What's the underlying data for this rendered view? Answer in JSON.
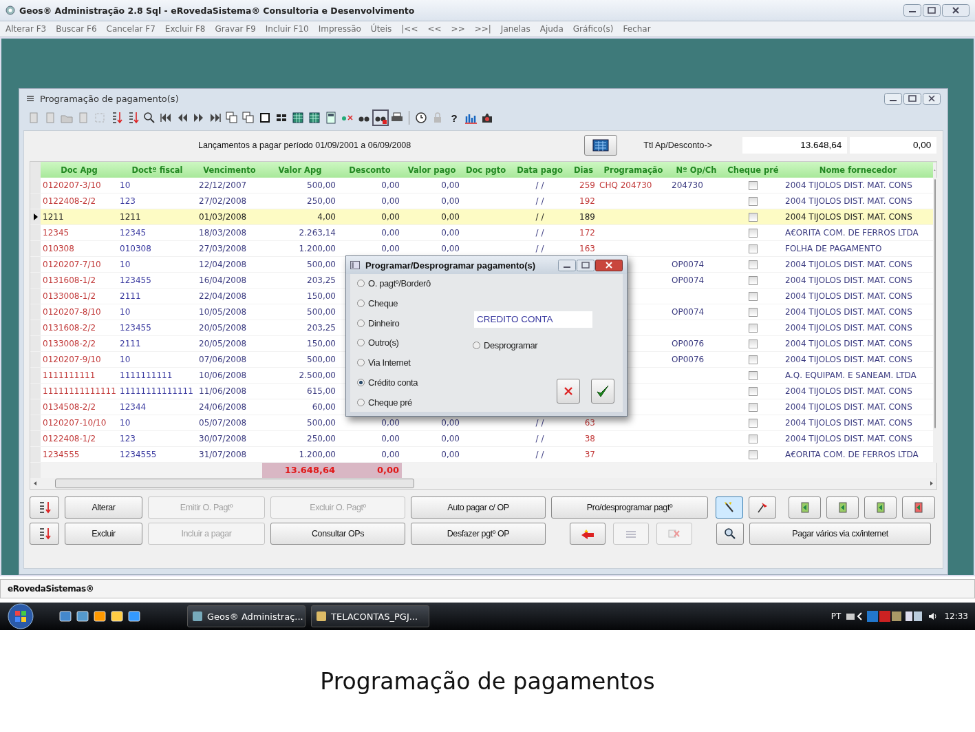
{
  "window": {
    "title": "Geos® Administração 2.8 Sql - eRovedaSistema® Consultoria e Desenvolvimento"
  },
  "menu": [
    "Alterar F3",
    "Buscar F6",
    "Cancelar F7",
    "Excluir F8",
    "Gravar F9",
    "Incluir F10",
    "Impressão",
    "Úteis",
    "|<<",
    "<<",
    ">>",
    ">>|",
    "Janelas",
    "Ajuda",
    "Gráfico(s)",
    "Fechar"
  ],
  "child_window": {
    "title": "Programação de pagamento(s)"
  },
  "toolbar": [
    {
      "kind": "icon",
      "pressed": false
    },
    {
      "kind": "icon",
      "pressed": false
    },
    {
      "kind": "icon",
      "pressed": false
    },
    {
      "kind": "icon",
      "pressed": false
    },
    {
      "kind": "icon",
      "pressed": false
    },
    {
      "kind": "icon",
      "pressed": false
    },
    {
      "kind": "icon",
      "pressed": false
    },
    {
      "kind": "icon",
      "pressed": false
    },
    {
      "kind": "icon",
      "pressed": false
    },
    {
      "kind": "icon",
      "pressed": false
    },
    {
      "kind": "icon",
      "pressed": false
    },
    {
      "kind": "icon",
      "pressed": false
    },
    {
      "kind": "icon",
      "pressed": false
    },
    {
      "kind": "icon",
      "pressed": false
    },
    {
      "kind": "icon",
      "pressed": false
    },
    {
      "kind": "icon",
      "pressed": false
    },
    {
      "kind": "icon",
      "pressed": false
    },
    {
      "kind": "icon",
      "pressed": false
    },
    {
      "kind": "icon",
      "pressed": false
    },
    {
      "kind": "icon",
      "pressed": false
    },
    {
      "kind": "icon",
      "pressed": false
    },
    {
      "kind": "icon",
      "pressed": true
    },
    {
      "kind": "icon",
      "pressed": false
    },
    {
      "kind": "separator"
    },
    {
      "kind": "icon",
      "pressed": false
    },
    {
      "kind": "icon",
      "pressed": false
    },
    {
      "kind": "text",
      "label": "?",
      "pressed": false
    },
    {
      "kind": "icon",
      "pressed": false
    },
    {
      "kind": "icon",
      "pressed": false
    }
  ],
  "period_label": "Lançamentos a pagar período 01/09/2001 a 06/09/2008",
  "totals_label": "Ttl Ap/Desconto->",
  "total_fields": [
    "13.648,64",
    "0,00"
  ],
  "table": {
    "columns": [
      "Doc Apg",
      "Doctº fiscal",
      "Vencimento",
      "Valor Apg",
      "Desconto",
      "Valor pago",
      "Doc pgto",
      "Data pago",
      "Dias",
      "Programação",
      "Nº Op/Ch",
      "Cheque pré",
      "Nome fornecedor"
    ],
    "rows": [
      {
        "doc": "0120207-3/10",
        "fiscal": "10",
        "venc": "22/12/2007",
        "valor": "500,00",
        "desc": "0,00",
        "pago": "0,00",
        "data": "/ /",
        "dias": "259",
        "prog": "CHQ 204730",
        "op": "204730",
        "cheque_pre": false,
        "forn": "2004 TIJOLOS DIST. MAT. CONS",
        "selected": false
      },
      {
        "doc": "0122408-2/2",
        "fiscal": "123",
        "venc": "27/02/2008",
        "valor": "250,00",
        "desc": "0,00",
        "pago": "0,00",
        "data": "/ /",
        "dias": "192",
        "cheque_pre": false,
        "forn": "2004 TIJOLOS DIST. MAT. CONS",
        "selected": false
      },
      {
        "doc": "1211",
        "fiscal": "1211",
        "venc": "01/03/2008",
        "valor": "4,00",
        "desc": "0,00",
        "pago": "0,00",
        "data": "/ /",
        "dias": "189",
        "cheque_pre": false,
        "forn": "2004 TIJOLOS DIST. MAT. CONS",
        "selected": true
      },
      {
        "doc": "12345",
        "fiscal": "12345",
        "venc": "18/03/2008",
        "valor": "2.263,14",
        "desc": "0,00",
        "pago": "0,00",
        "data": "/ /",
        "dias": "172",
        "cheque_pre": false,
        "forn": "A€ORITA COM. DE FERROS LTDA",
        "selected": false
      },
      {
        "doc": "010308",
        "fiscal": "010308",
        "venc": "27/03/2008",
        "valor": "1.200,00",
        "desc": "0,00",
        "pago": "0,00",
        "data": "/ /",
        "dias": "163",
        "cheque_pre": false,
        "forn": "FOLHA DE PAGAMENTO",
        "selected": false
      },
      {
        "doc": "0120207-7/10",
        "fiscal": "10",
        "venc": "12/04/2008",
        "valor": "500,00",
        "op": "OP0074",
        "cheque_pre": false,
        "forn": "2004 TIJOLOS DIST. MAT. CONS",
        "selected": false
      },
      {
        "doc": "0131608-1/2",
        "fiscal": "123455",
        "venc": "16/04/2008",
        "valor": "203,25",
        "op": "OP0074",
        "cheque_pre": false,
        "forn": "2004 TIJOLOS DIST. MAT. CONS",
        "selected": false
      },
      {
        "doc": "0133008-1/2",
        "fiscal": "2111",
        "venc": "22/04/2008",
        "valor": "150,00",
        "cheque_pre": false,
        "forn": "2004 TIJOLOS DIST. MAT. CONS",
        "selected": false
      },
      {
        "doc": "0120207-8/10",
        "fiscal": "10",
        "venc": "10/05/2008",
        "valor": "500,00",
        "op": "OP0074",
        "cheque_pre": false,
        "forn": "2004 TIJOLOS DIST. MAT. CONS",
        "selected": false
      },
      {
        "doc": "0131608-2/2",
        "fiscal": "123455",
        "venc": "20/05/2008",
        "valor": "203,25",
        "cheque_pre": false,
        "forn": "2004 TIJOLOS DIST. MAT. CONS",
        "selected": false
      },
      {
        "doc": "0133008-2/2",
        "fiscal": "2111",
        "venc": "20/05/2008",
        "valor": "150,00",
        "op": "OP0076",
        "cheque_pre": false,
        "forn": "2004 TIJOLOS DIST. MAT. CONS",
        "selected": false
      },
      {
        "doc": "0120207-9/10",
        "fiscal": "10",
        "venc": "07/06/2008",
        "valor": "500,00",
        "op": "OP0076",
        "cheque_pre": false,
        "forn": "2004 TIJOLOS DIST. MAT. CONS",
        "selected": false
      },
      {
        "doc": "1111111111",
        "fiscal": "1111111111",
        "venc": "10/06/2008",
        "valor": "2.500,00",
        "cheque_pre": false,
        "forn": "A.Q. EQUIPAM. E SANEAM. LTDA",
        "selected": false
      },
      {
        "doc": "11111111111111",
        "fiscal": "11111111111111",
        "venc": "11/06/2008",
        "valor": "615,00",
        "cheque_pre": false,
        "forn": "2004 TIJOLOS DIST. MAT. CONS",
        "selected": false
      },
      {
        "doc": "0134508-2/2",
        "fiscal": "12344",
        "venc": "24/06/2008",
        "valor": "60,00",
        "cheque_pre": false,
        "forn": "2004 TIJOLOS DIST. MAT. CONS",
        "selected": false
      },
      {
        "doc": "0120207-10/10",
        "fiscal": "10",
        "venc": "05/07/2008",
        "valor": "500,00",
        "desc": "0,00",
        "pago": "0,00",
        "data": "/ /",
        "dias": "63",
        "cheque_pre": false,
        "forn": "2004 TIJOLOS DIST. MAT. CONS",
        "selected": false
      },
      {
        "doc": "0122408-1/2",
        "fiscal": "123",
        "venc": "30/07/2008",
        "valor": "250,00",
        "desc": "0,00",
        "pago": "0,00",
        "data": "/ /",
        "dias": "38",
        "cheque_pre": false,
        "forn": "2004 TIJOLOS DIST. MAT. CONS",
        "selected": false
      },
      {
        "doc": "1234555",
        "fiscal": "1234555",
        "venc": "31/07/2008",
        "valor": "1.200,00",
        "desc": "0,00",
        "pago": "0,00",
        "data": "/ /",
        "dias": "37",
        "cheque_pre": false,
        "forn": "A€ORITA COM. DE FERROS LTDA",
        "selected": false
      }
    ],
    "totals": {
      "valor": "13.648,64",
      "desc": "0,00"
    }
  },
  "dialog": {
    "title": "Programar/Desprogramar pagamento(s)",
    "options": [
      {
        "label": "O. pagtº/Borderô",
        "selected": false
      },
      {
        "label": "Cheque",
        "selected": false
      },
      {
        "label": "Dinheiro",
        "selected": false
      },
      {
        "label": "Outro(s)",
        "selected": false
      },
      {
        "label": "Via Internet",
        "selected": false
      },
      {
        "label": "Crédito conta",
        "selected": true
      },
      {
        "label": "Cheque pré",
        "selected": false
      }
    ],
    "field_value": "CREDITO CONTA",
    "unschedule": {
      "label": "Desprogramar",
      "selected": false
    }
  },
  "buttons": [
    [
      {
        "kind": "icon",
        "disabled": false,
        "pressed": false
      },
      {
        "kind": "text",
        "label": "Alterar",
        "disabled": false
      },
      {
        "kind": "text",
        "label": "Emitir O. Pagtº",
        "disabled": true
      },
      {
        "kind": "text",
        "label": "Excluir O. Pagtº",
        "disabled": true
      },
      {
        "kind": "text",
        "label": "Auto pagar c/ OP",
        "disabled": false
      },
      {
        "kind": "text",
        "label": "Pro/desprogramar pagtº",
        "disabled": false
      },
      {
        "kind": "icon",
        "disabled": false,
        "pressed": true
      },
      {
        "kind": "icon",
        "disabled": false,
        "pressed": false
      },
      {
        "kind": "icon",
        "disabled": false,
        "pressed": false
      },
      {
        "kind": "icon",
        "disabled": false,
        "pressed": false
      },
      {
        "kind": "icon",
        "disabled": false,
        "pressed": false
      },
      {
        "kind": "icon",
        "disabled": false,
        "pressed": false
      }
    ],
    [
      {
        "kind": "icon",
        "disabled": false,
        "pressed": false
      },
      {
        "kind": "text",
        "label": "Excluir",
        "disabled": false
      },
      {
        "kind": "text",
        "label": "Incluir a pagar",
        "disabled": true
      },
      {
        "kind": "text",
        "label": "Consultar OPs",
        "disabled": false
      },
      {
        "kind": "text",
        "label": "Desfazer pgtº OP",
        "disabled": false
      },
      {
        "kind": "icon",
        "disabled": false,
        "pressed": false
      },
      {
        "kind": "icon",
        "disabled": true,
        "pressed": false
      },
      {
        "kind": "icon",
        "disabled": true,
        "pressed": false
      },
      {
        "kind": "icon",
        "disabled": false,
        "pressed": false
      },
      {
        "kind": "text",
        "label": "Pagar vários via cx/internet",
        "disabled": false
      }
    ]
  ],
  "status_bar": "eRovedaSistemas®",
  "taskbar": {
    "tasks": [
      "Geos® Administraç...",
      "TELACONTAS_PGJ..."
    ],
    "language": "PT",
    "clock": "12:33"
  },
  "caption": "Programação de pagamentos"
}
